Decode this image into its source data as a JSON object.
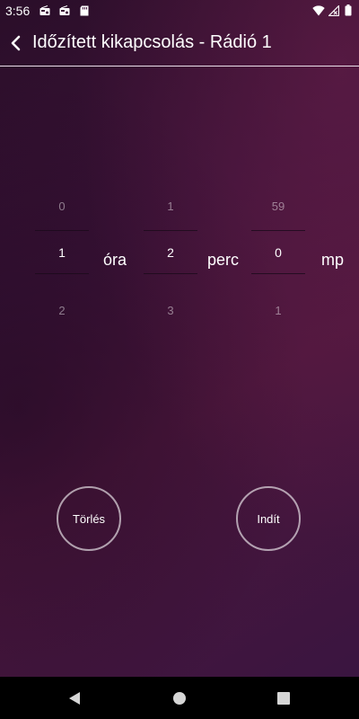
{
  "status_bar": {
    "time": "3:56",
    "icons": [
      "radio-notification-icon",
      "radio-notification-icon",
      "sd-card-icon",
      "wifi-icon",
      "signal-off-icon",
      "battery-icon"
    ]
  },
  "appbar": {
    "title": "Időzített kikapcsolás - Rádió 1",
    "back_icon": "arrow-back-icon"
  },
  "timer": {
    "hours": {
      "above": "0",
      "current": "1",
      "below": "2",
      "unit": "óra"
    },
    "minutes": {
      "above": "1",
      "current": "2",
      "below": "3",
      "unit": "perc"
    },
    "seconds": {
      "above": "59",
      "current": "0",
      "below": "1",
      "unit": "mp"
    }
  },
  "buttons": {
    "clear_label": "Törlés",
    "start_label": "Indít"
  },
  "navigation": [
    "back-triangle-icon",
    "home-circle-icon",
    "recents-square-icon"
  ],
  "colors": {
    "background_dark": "#2a0e29",
    "background_mid": "#4b163c",
    "text": "#ffffff"
  }
}
